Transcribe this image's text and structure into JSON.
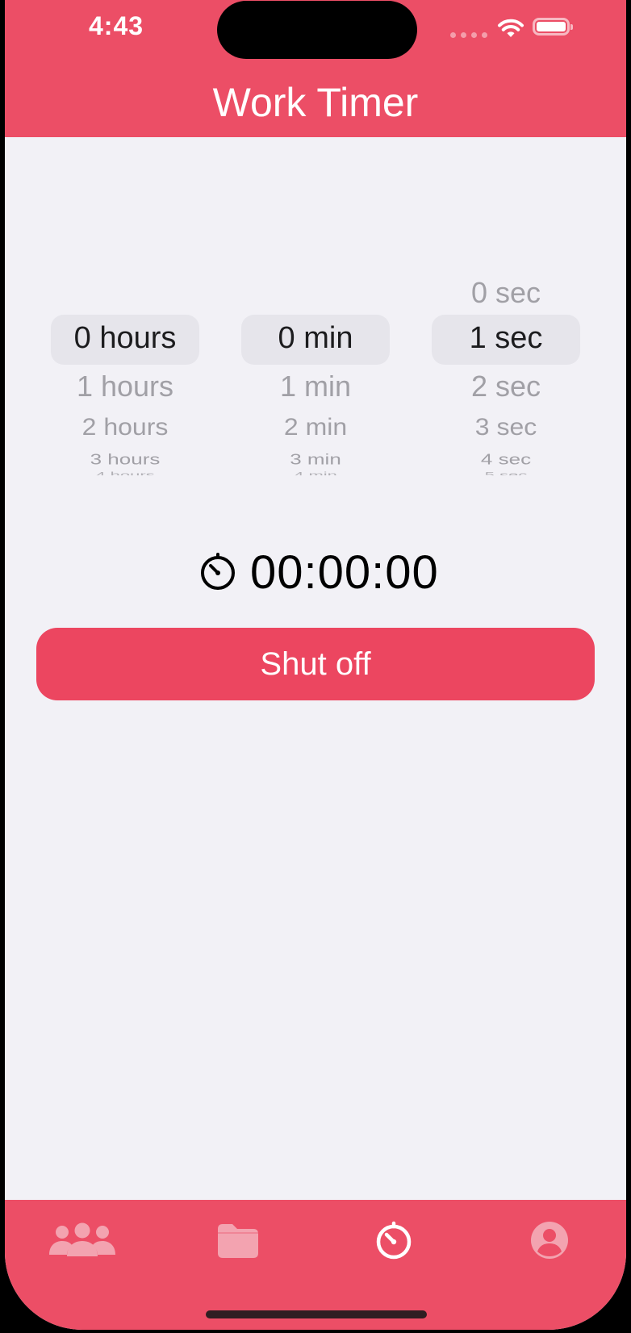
{
  "status_bar": {
    "time": "4:43"
  },
  "header": {
    "title": "Work Timer"
  },
  "pickers": {
    "hours": {
      "items": [
        "0 hours",
        "1 hours",
        "2 hours",
        "3 hours",
        "4 hours"
      ],
      "selected": "0 hours"
    },
    "minutes": {
      "items": [
        "0 min",
        "1 min",
        "2 min",
        "3 min",
        "4 min"
      ],
      "selected": "0 min"
    },
    "seconds": {
      "items": [
        "0 sec",
        "1 sec",
        "2 sec",
        "3 sec",
        "4 sec",
        "5 sec"
      ],
      "selected": "1 sec"
    }
  },
  "timer": {
    "display": "00:00:00",
    "icon": "stopwatch-icon"
  },
  "actions": {
    "shutoff_label": "Shut off"
  },
  "tabbar": {
    "tabs": [
      {
        "icon": "people-icon",
        "active": false
      },
      {
        "icon": "folder-icon",
        "active": false
      },
      {
        "icon": "stopwatch-icon",
        "active": true
      },
      {
        "icon": "profile-icon",
        "active": false
      }
    ]
  },
  "colors": {
    "accent": "#EC4E66",
    "button": "#EC4660",
    "background": "#F2F1F6",
    "picker_highlight": "#E6E5EB",
    "picker_dim_text": "#A1A0A6",
    "tab_inactive": "#F3A3B0",
    "tab_active": "#FFFFFF"
  }
}
